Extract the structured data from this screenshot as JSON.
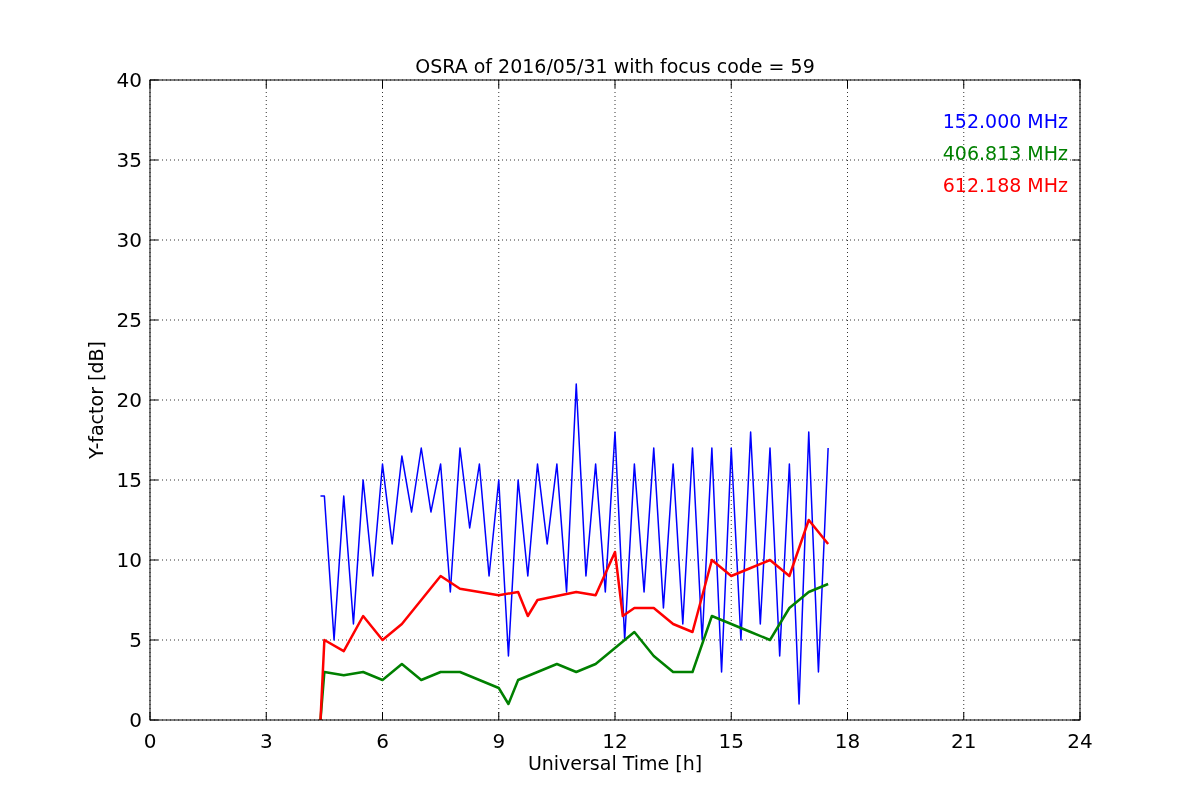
{
  "chart_data": {
    "type": "line",
    "title": "OSRA of 2016/05/31 with focus code = 59",
    "xlabel": "Universal Time [h]",
    "ylabel": "Y-factor [dB]",
    "xlim": [
      0,
      24
    ],
    "ylim": [
      0,
      40
    ],
    "xticks": [
      0,
      3,
      6,
      9,
      12,
      15,
      18,
      21,
      24
    ],
    "yticks": [
      0,
      5,
      10,
      15,
      20,
      25,
      30,
      35,
      40
    ],
    "grid": true,
    "series": [
      {
        "name": "152.000 MHz",
        "color": "#0000ff",
        "x": [
          4.4,
          4.5,
          4.75,
          5,
          5.25,
          5.5,
          5.75,
          6,
          6.25,
          6.5,
          6.75,
          7,
          7.25,
          7.5,
          7.75,
          8,
          8.25,
          8.5,
          8.75,
          9,
          9.25,
          9.5,
          9.75,
          10,
          10.25,
          10.5,
          10.75,
          11,
          11.25,
          11.5,
          11.75,
          12,
          12.25,
          12.5,
          12.75,
          13,
          13.25,
          13.5,
          13.75,
          14,
          14.25,
          14.5,
          14.75,
          15,
          15.25,
          15.5,
          15.75,
          16,
          16.25,
          16.5,
          16.75,
          17,
          17.25,
          17.5
        ],
        "values": [
          14,
          14,
          5,
          14,
          6,
          15,
          9,
          16,
          11,
          16.5,
          13,
          17,
          13,
          16,
          8,
          17,
          12,
          16,
          9,
          15,
          4,
          15,
          9,
          16,
          11,
          16,
          8,
          21,
          9,
          16,
          8,
          18,
          5,
          16,
          8,
          17,
          7,
          16,
          6,
          17,
          5,
          17,
          3,
          17,
          5,
          18,
          6,
          17,
          4,
          16,
          1,
          18,
          3,
          17
        ]
      },
      {
        "name": "406.813 MHz",
        "color": "#008000",
        "x": [
          4.4,
          4.5,
          5,
          5.5,
          6,
          6.5,
          7,
          7.5,
          8,
          8.5,
          9,
          9.25,
          9.5,
          10,
          10.5,
          11,
          11.5,
          12,
          12.5,
          13,
          13.5,
          14,
          14.5,
          15,
          15.5,
          16,
          16.5,
          17,
          17.5
        ],
        "values": [
          0,
          3,
          2.8,
          3,
          2.5,
          3.5,
          2.5,
          3,
          3,
          2.5,
          2,
          1,
          2.5,
          3,
          3.5,
          3,
          3.5,
          4.5,
          5.5,
          4,
          3,
          3,
          6.5,
          6,
          5.5,
          5,
          7,
          8,
          8.5
        ]
      },
      {
        "name": "612.188 MHz",
        "color": "#ff0000",
        "x": [
          4.4,
          4.5,
          5,
          5.5,
          6,
          6.5,
          7,
          7.5,
          8,
          8.5,
          9,
          9.5,
          9.75,
          10,
          11,
          11.5,
          12,
          12.2,
          12.5,
          13,
          13.5,
          14,
          14.5,
          15,
          15.5,
          16,
          16.5,
          17,
          17.5
        ],
        "values": [
          0,
          5,
          4.3,
          6.5,
          5,
          6,
          7.5,
          9,
          8.2,
          8,
          7.8,
          8,
          6.5,
          7.5,
          8,
          7.8,
          10.5,
          6.5,
          7,
          7,
          6,
          5.5,
          10,
          9,
          9.5,
          10,
          9,
          12.5,
          11
        ]
      }
    ]
  }
}
